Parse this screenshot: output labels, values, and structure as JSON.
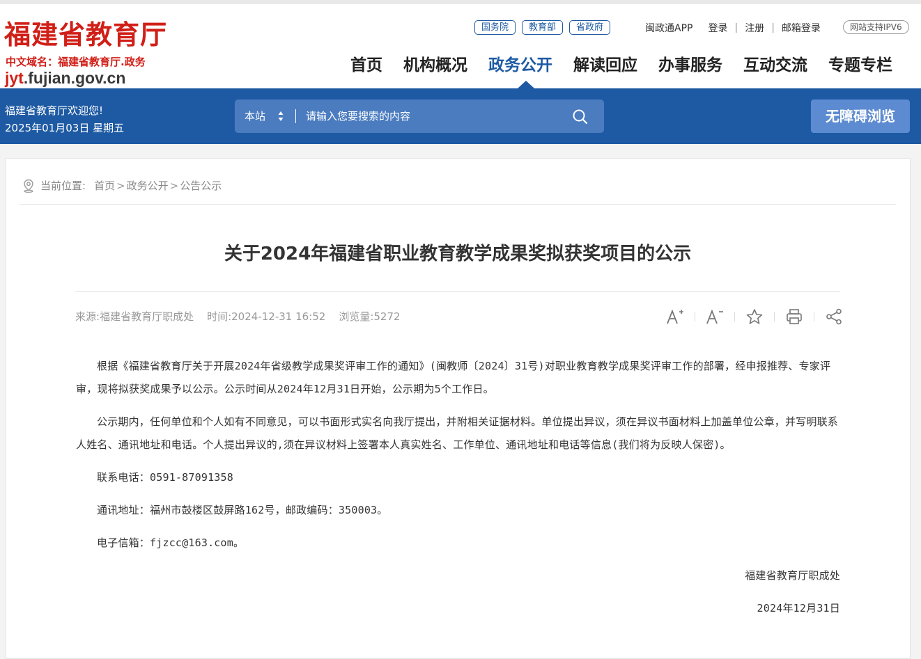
{
  "header": {
    "logo_title": "福建省教育厅",
    "logo_domain": "中文域名：福建省教育厅.政务",
    "logo_url_prefix": "jyt",
    "logo_url_rest": ".fujian.gov.cn",
    "ext_links": [
      "国务院",
      "教育部",
      "省政府"
    ],
    "top_links": {
      "app": "闽政通APP",
      "login": "登录",
      "register": "注册",
      "mail": "邮箱登录"
    },
    "ipv6": "网站支持IPV6",
    "nav": [
      "首页",
      "机构概况",
      "政务公开",
      "解读回应",
      "办事服务",
      "互动交流",
      "专题专栏"
    ],
    "nav_active": "政务公开"
  },
  "band": {
    "welcome": "福建省教育厅欢迎您!",
    "date": "2025年01月03日 星期五",
    "search_scope": "本站",
    "search_placeholder": "请输入您要搜索的内容",
    "accessibility": "无障碍浏览"
  },
  "breadcrumb": {
    "label": "当前位置:",
    "items": [
      "首页",
      "政务公开",
      "公告公示"
    ],
    "arrow": ">"
  },
  "article": {
    "title": "关于2024年福建省职业教育教学成果奖拟获奖项目的公示",
    "meta": {
      "source_label": "来源:",
      "source": "福建省教育厅职成处",
      "time_label": "时间:",
      "time": "2024-12-31 16:52",
      "views_label": "浏览量:",
      "views": "5272"
    },
    "paragraphs": [
      "根据《福建省教育厅关于开展2024年省级教学成果奖评审工作的通知》(闽教师〔2024〕31号)对职业教育教学成果奖评审工作的部署，经申报推荐、专家评审，现将拟获奖成果予以公示。公示时间从2024年12月31日开始，公示期为5个工作日。",
      "公示期内，任何单位和个人如有不同意见，可以书面形式实名向我厅提出，并附相关证据材料。单位提出异议，须在异议书面材料上加盖单位公章，并写明联系人姓名、通讯地址和电话。个人提出异议的,须在异议材料上签署本人真实姓名、工作单位、通讯地址和电话等信息(我们将为反映人保密)。",
      "联系电话：0591-87091358",
      "通讯地址：福州市鼓楼区鼓屏路162号，邮政编码：350003。",
      "电子信箱：fjzcc@163.com。"
    ],
    "signature": "福建省教育厅职成处",
    "sign_date": "2024年12月31日"
  },
  "colors": {
    "brand_red": "#d01f17",
    "brand_blue": "#1e5aa3"
  }
}
